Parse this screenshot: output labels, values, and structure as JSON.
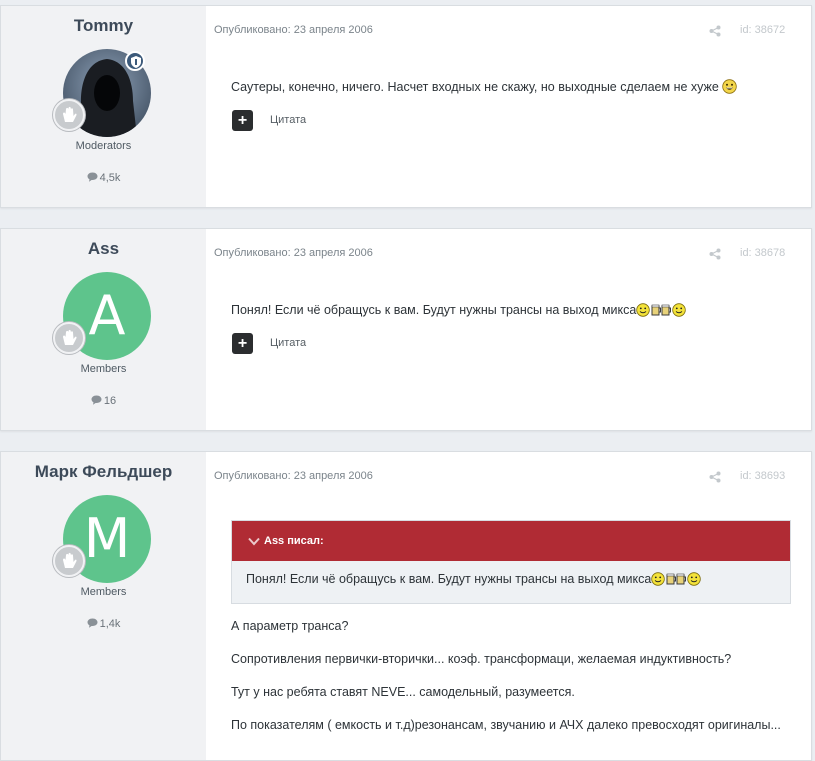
{
  "colors": {
    "accent_quote": "#b02b34",
    "avatar_green": "#5ec48c",
    "author_panel": "#f1f2f4"
  },
  "posts": [
    {
      "author": "Tommy",
      "avatar_kind": "hooded-figure-photo",
      "group": "Moderators",
      "post_count": "4,5k",
      "date": "Опубликовано: 23 апреля 2006",
      "id_text": "id: 38672",
      "content": "Саутеры, конечно, ничего. Насчет входных не скажу, но выходные сделаем не хуже",
      "quote_label": "Цитата"
    },
    {
      "author": "Ass",
      "avatar_letter": "A",
      "group": "Members",
      "post_count": "16",
      "date": "Опубликовано: 23 апреля 2006",
      "id_text": "id: 38678",
      "content": "Понял! Если чё обращусь к вам. Будут нужны трансы на выход микса",
      "quote_label": "Цитата"
    },
    {
      "author": "Марк Фельдшер",
      "avatar_letter": "M",
      "group": "Members",
      "post_count": "1,4k",
      "date": "Опубликовано: 23 апреля 2006",
      "id_text": "id: 38693",
      "quote": {
        "header": "Ass писал:",
        "text": "Понял! Если чё обращусь к вам. Будут нужны трансы на выход микса"
      },
      "paragraphs": [
        "А параметр транса?",
        "Сопротивления первички-вторички... коэф. трансформаци, желаемая индуктивность?",
        "Тут у нас ребята ставят NEVE... самодельный, разумеется.",
        "По показателям ( емкость и т.д)резонансам, звучанию и АЧХ далеко превосходят оригиналы..."
      ]
    }
  ],
  "icons": {
    "share": "share-icon",
    "comment": "comment-icon",
    "rank": "rank-badge-icon",
    "moderator": "moderator-shield-icon",
    "smiley": "smiley-icon",
    "beer": "beer-mugs-icon",
    "quote_chevron": "chevron-down-icon",
    "plus": "plus-icon"
  }
}
